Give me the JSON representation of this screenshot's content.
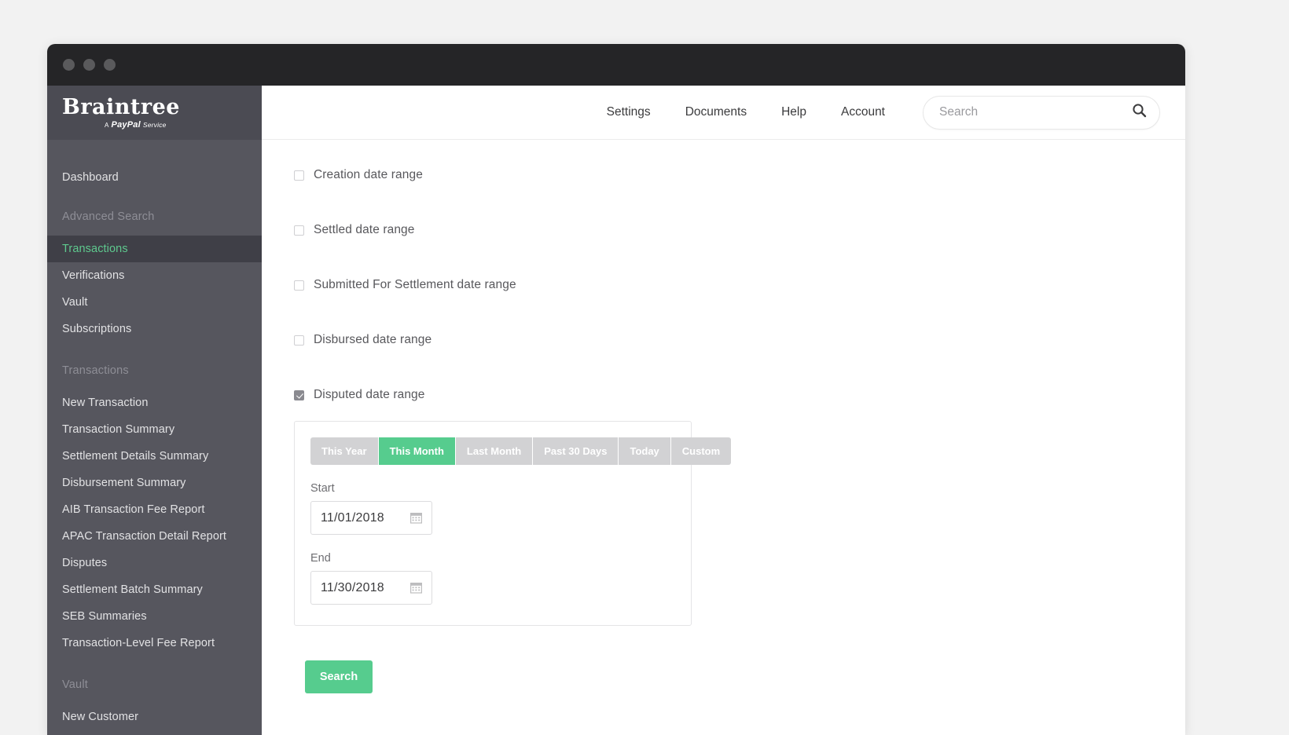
{
  "window": {
    "traffic_lights": [
      "close",
      "minimize",
      "maximize"
    ]
  },
  "brand": {
    "name": "Braintree",
    "tagline_a": "A",
    "tagline_paypal": "PayPal",
    "tagline_service": "Service"
  },
  "sidebar": {
    "groups": [
      {
        "header": null,
        "items": [
          {
            "label": "Dashboard",
            "active": false
          }
        ]
      },
      {
        "header": "Advanced Search",
        "items": [
          {
            "label": "Transactions",
            "active": true
          },
          {
            "label": "Verifications",
            "active": false
          },
          {
            "label": "Vault",
            "active": false
          },
          {
            "label": "Subscriptions",
            "active": false
          }
        ]
      },
      {
        "header": "Transactions",
        "items": [
          {
            "label": "New Transaction",
            "active": false
          },
          {
            "label": "Transaction Summary",
            "active": false
          },
          {
            "label": "Settlement Details Summary",
            "active": false
          },
          {
            "label": "Disbursement Summary",
            "active": false
          },
          {
            "label": "AIB Transaction Fee Report",
            "active": false
          },
          {
            "label": "APAC Transaction Detail Report",
            "active": false
          },
          {
            "label": "Disputes",
            "active": false
          },
          {
            "label": "Settlement Batch Summary",
            "active": false
          },
          {
            "label": "SEB Summaries",
            "active": false
          },
          {
            "label": "Transaction-Level Fee Report",
            "active": false
          }
        ]
      },
      {
        "header": "Vault",
        "items": [
          {
            "label": "New Customer",
            "active": false
          }
        ]
      }
    ]
  },
  "topbar": {
    "links": [
      {
        "label": "Settings"
      },
      {
        "label": "Documents"
      },
      {
        "label": "Help"
      },
      {
        "label": "Account"
      }
    ],
    "search": {
      "placeholder": "Search",
      "value": "",
      "icon": "search-icon"
    }
  },
  "filters": [
    {
      "label": "Creation date range",
      "checked": false
    },
    {
      "label": "Settled date range",
      "checked": false
    },
    {
      "label": "Submitted For Settlement date range",
      "checked": false
    },
    {
      "label": "Disbursed date range",
      "checked": false
    },
    {
      "label": "Disputed date range",
      "checked": true
    }
  ],
  "date_range_panel": {
    "tabs": [
      {
        "label": "This Year",
        "active": false
      },
      {
        "label": "This Month",
        "active": true
      },
      {
        "label": "Last Month",
        "active": false
      },
      {
        "label": "Past 30 Days",
        "active": false
      },
      {
        "label": "Today",
        "active": false
      },
      {
        "label": "Custom",
        "active": false
      }
    ],
    "start": {
      "label": "Start",
      "value": "11/01/2018",
      "icon": "calendar-icon"
    },
    "end": {
      "label": "End",
      "value": "11/30/2018",
      "icon": "calendar-icon"
    }
  },
  "actions": {
    "search_label": "Search"
  },
  "colors": {
    "accent_green": "#56cc8e",
    "sidebar": "#56565e",
    "sidebar_brand": "#4b4b53",
    "sidebar_active": "#3f3f47",
    "active_text": "#5ec98e",
    "titlebar": "#252527",
    "canvas": "#f2f2f2"
  }
}
